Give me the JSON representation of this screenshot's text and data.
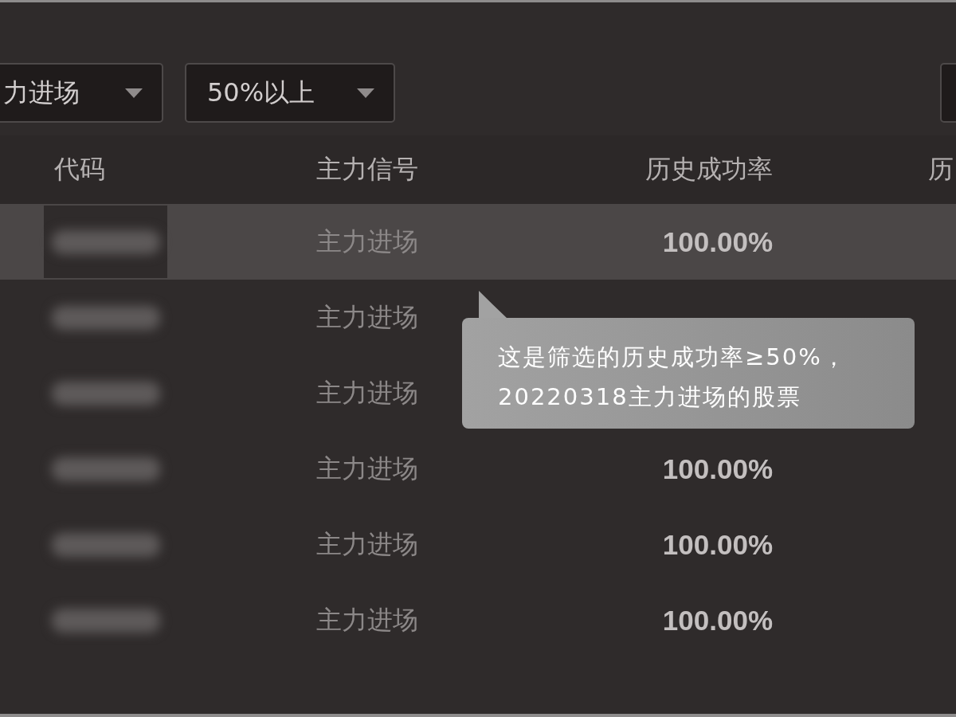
{
  "filters": [
    {
      "value": "力进场"
    },
    {
      "value": "50%以上"
    }
  ],
  "table": {
    "columns": [
      "代码",
      "主力信号",
      "历史成功率",
      "历"
    ],
    "rows": [
      {
        "selected": true,
        "signal": "主力进场",
        "success_rate": "100.00%"
      },
      {
        "selected": false,
        "signal": "主力进场"
      },
      {
        "selected": false,
        "signal": "主力进场"
      },
      {
        "selected": false,
        "signal": "主力进场",
        "success_rate": "100.00%"
      },
      {
        "selected": false,
        "signal": "主力进场",
        "success_rate": "100.00%"
      },
      {
        "selected": false,
        "signal": "主力进场",
        "success_rate": "100.00%"
      }
    ]
  },
  "tooltip": {
    "text": "这是筛选的历史成功率≥50%，20220318主力进场的股票"
  }
}
